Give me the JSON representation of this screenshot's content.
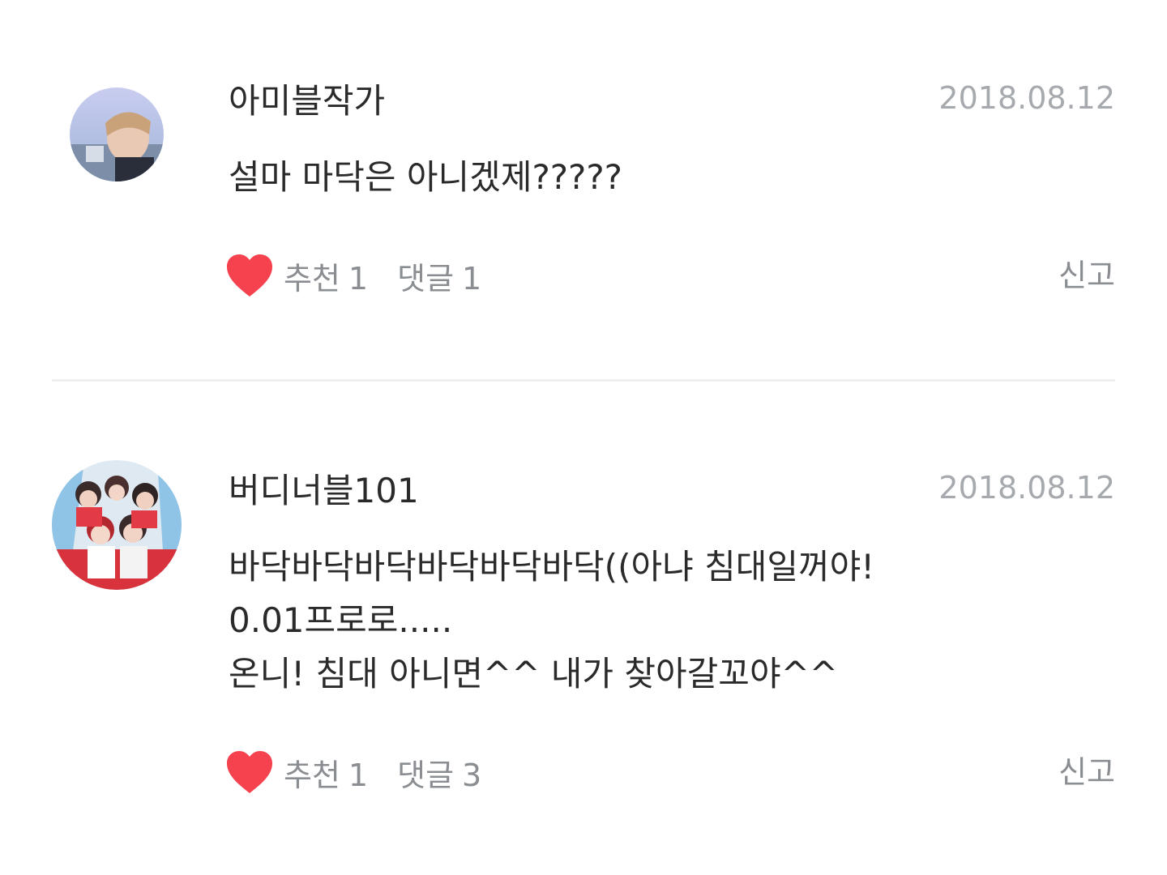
{
  "comments": [
    {
      "author": "아미블작가",
      "date": "2018.08.12",
      "body": "설마 마닥은 아니겠제?????",
      "like_label": "추천",
      "like_count": "1",
      "reply_label": "댓글",
      "reply_count": "1",
      "report_label": "신고",
      "avatar_icon": "profile-photo",
      "heart_color": "#f5424e"
    },
    {
      "author": "버디너블101",
      "date": "2018.08.12",
      "body": "바닥바닥바닥바닥바닥바닥((아냐 침대일꺼야!\n0.01프로로.....\n온니!  침대 아니면^^ 내가 찾아갈꼬야^^",
      "like_label": "추천",
      "like_count": "1",
      "reply_label": "댓글",
      "reply_count": "3",
      "report_label": "신고",
      "avatar_icon": "group-photo",
      "heart_color": "#f5424e"
    }
  ]
}
